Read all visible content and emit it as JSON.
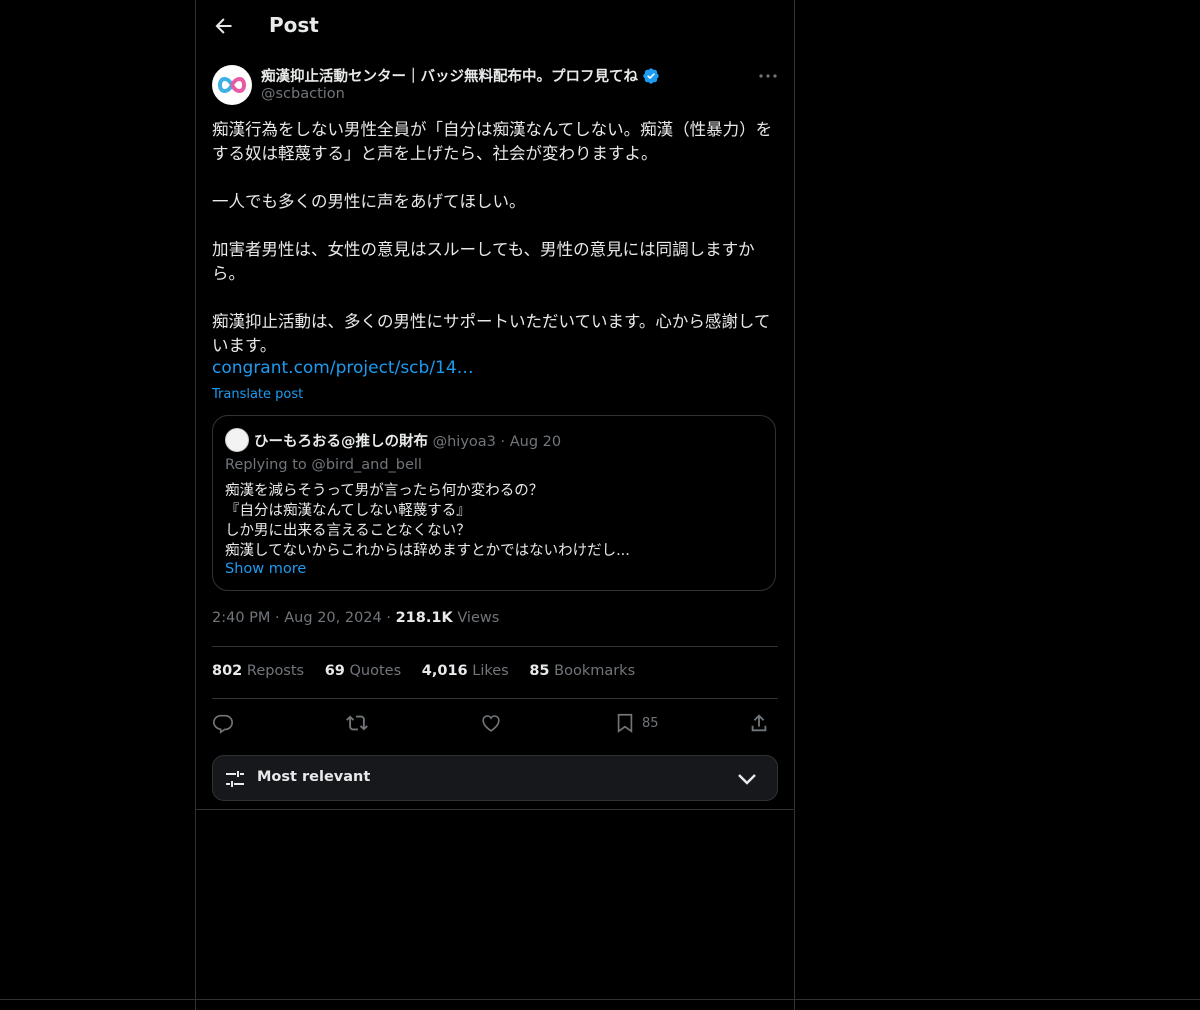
{
  "header": {
    "title": "Post"
  },
  "post": {
    "author_name": "痴漢抑止活動センター｜バッジ無料配布中。プロフ見てね",
    "author_handle": "@scbaction",
    "text": "痴漢行為をしない男性全員が「自分は痴漢なんてしない。痴漢（性暴力）をする奴は軽蔑する」と声を上げたら、社会が変わりますよ。\n\n一人でも多くの男性に声をあげてほしい。\n\n加害者男性は、女性の意見はスルーしても、男性の意見には同調しますから。\n\n痴漢抑止活動は、多くの男性にサポートいただいています。心から感謝しています。",
    "link": "congrant.com/project/scb/14…",
    "translate_label": "Translate post",
    "time": "2:40 PM",
    "date": "Aug 20, 2024",
    "views_count": "218.1K",
    "views_label": "Views"
  },
  "quote": {
    "name": "ひーもろおる@推しの財布",
    "handle": "@hiyoa3",
    "date": "Aug 20",
    "replying_to": "Replying to @bird_and_bell",
    "text": "痴漢を減らそうって男が言ったら何か変わるの？\n『自分は痴漢なんてしない軽蔑する』\nしか男に出来る言えることなくない？\n痴漢してないからこれからは辞めますとかではないわけだし...",
    "show_more": "Show more"
  },
  "stats": {
    "reposts_count": "802",
    "reposts_label": "Reposts",
    "quotes_count": "69",
    "quotes_label": "Quotes",
    "likes_count": "4,016",
    "likes_label": "Likes",
    "bookmarks_count": "85",
    "bookmarks_label": "Bookmarks"
  },
  "actions": {
    "bookmark_count": "85"
  },
  "sort": {
    "label": "Most relevant"
  },
  "icons": {
    "back": "arrow-left-icon",
    "verified": "verified-badge-icon",
    "more": "more-horizontal-icon",
    "reply": "reply-icon",
    "repost": "repost-icon",
    "like": "heart-icon",
    "bookmark": "bookmark-icon",
    "share": "share-icon",
    "sort": "sliders-icon",
    "chevron": "chevron-down-icon"
  },
  "colors": {
    "accent": "#1d9bf0",
    "background": "#000000",
    "border": "#2f3336",
    "muted": "#71767b"
  }
}
